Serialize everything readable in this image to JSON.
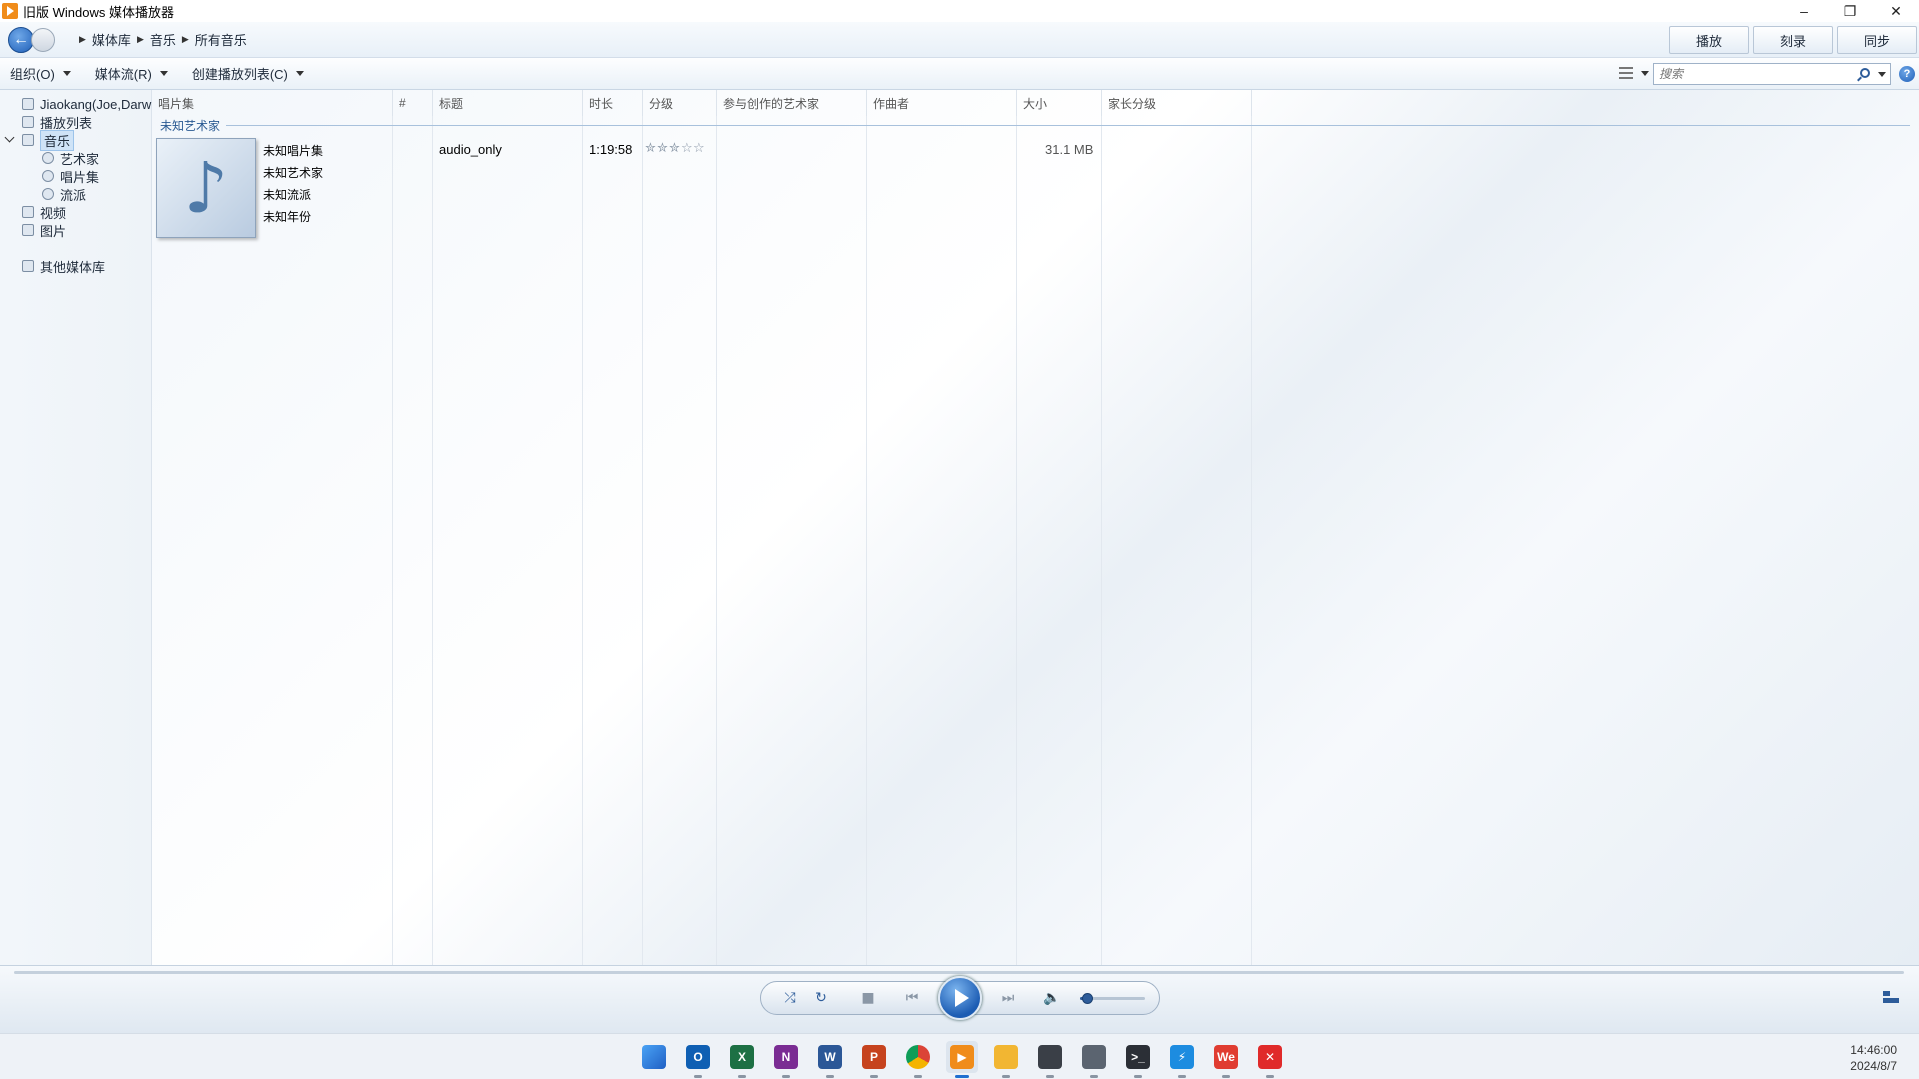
{
  "window": {
    "title": "旧版 Windows 媒体播放器",
    "minimize": "–",
    "restore": "❐",
    "close": "✕"
  },
  "nav": {
    "breadcrumb": [
      "媒体库",
      "音乐",
      "所有音乐"
    ],
    "tabs": [
      "播放",
      "刻录",
      "同步"
    ]
  },
  "toolbar": {
    "organize": "组织(O)",
    "stream": "媒体流(R)",
    "create_playlist": "创建播放列表(C)",
    "search_placeholder": "搜索",
    "help": "?"
  },
  "sidebar": {
    "user": "Jiaokang(Joe,Darw",
    "playlists": "播放列表",
    "music": "音乐",
    "artists": "艺术家",
    "albums": "唱片集",
    "genres": "流派",
    "videos": "视频",
    "pictures": "图片",
    "other_libraries": "其他媒体库"
  },
  "columns": [
    "唱片集",
    "#",
    "标题",
    "时长",
    "分级",
    "参与创作的艺术家",
    "作曲者",
    "大小",
    "家长分级"
  ],
  "group": {
    "artist": "未知艺术家",
    "album_info": [
      "未知唱片集",
      "未知艺术家",
      "未知流派",
      "未知年份"
    ]
  },
  "track": {
    "title": "audio_only",
    "length": "1:19:58",
    "rating_stars": 3,
    "rating_total": 5,
    "size": "31.1 MB"
  },
  "player": {
    "volume": 0.1,
    "progress": 0
  },
  "taskbar": {
    "apps": [
      {
        "name": "start",
        "glyph": "",
        "color": "#1f78d1"
      },
      {
        "name": "outlook",
        "glyph": "O",
        "color": "#0f5fb3"
      },
      {
        "name": "excel",
        "glyph": "X",
        "color": "#1d7044"
      },
      {
        "name": "onenote",
        "glyph": "N",
        "color": "#7a2c93"
      },
      {
        "name": "word",
        "glyph": "W",
        "color": "#2b5797"
      },
      {
        "name": "powerpoint",
        "glyph": "P",
        "color": "#c6431e"
      },
      {
        "name": "chrome",
        "glyph": "",
        "color": "#db4437"
      },
      {
        "name": "media-player",
        "glyph": "▶",
        "color": "#f08c1a"
      },
      {
        "name": "file-explorer",
        "glyph": "",
        "color": "#f2b632"
      },
      {
        "name": "snipping",
        "glyph": "",
        "color": "#3a3f47"
      },
      {
        "name": "calculator",
        "glyph": "",
        "color": "#5b6470"
      },
      {
        "name": "terminal",
        "glyph": ">_",
        "color": "#2b2f36"
      },
      {
        "name": "thunder",
        "glyph": "⚡",
        "color": "#1d8ce0"
      },
      {
        "name": "wps",
        "glyph": "We",
        "color": "#e03c31"
      },
      {
        "name": "xmind",
        "glyph": "✕",
        "color": "#e02a2a"
      }
    ],
    "time": "14:46:00",
    "date": "2024/8/7"
  }
}
